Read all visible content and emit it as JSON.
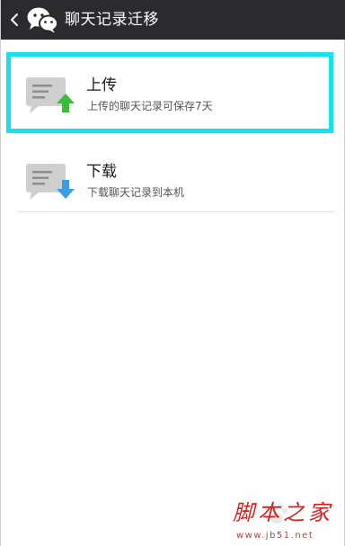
{
  "header": {
    "title": "聊天记录迁移",
    "back_icon": "chevron-left-icon",
    "logo_icon": "wechat-logo-icon"
  },
  "items": [
    {
      "title": "上传",
      "subtitle": "上传的聊天记录可保存7天",
      "icon": "chat-upload-icon",
      "arrow_color": "#3bbd3b",
      "highlighted": true
    },
    {
      "title": "下载",
      "subtitle": "下载聊天记录到本机",
      "icon": "chat-download-icon",
      "arrow_color": "#3a9ee5",
      "highlighted": false
    }
  ],
  "colors": {
    "titlebar": "#2b2b2d",
    "highlight_border": "#12e3ee",
    "watermark": "#d81e1e"
  },
  "watermark": {
    "logo_text": "脚本之家",
    "url": "www.jb51.net"
  }
}
